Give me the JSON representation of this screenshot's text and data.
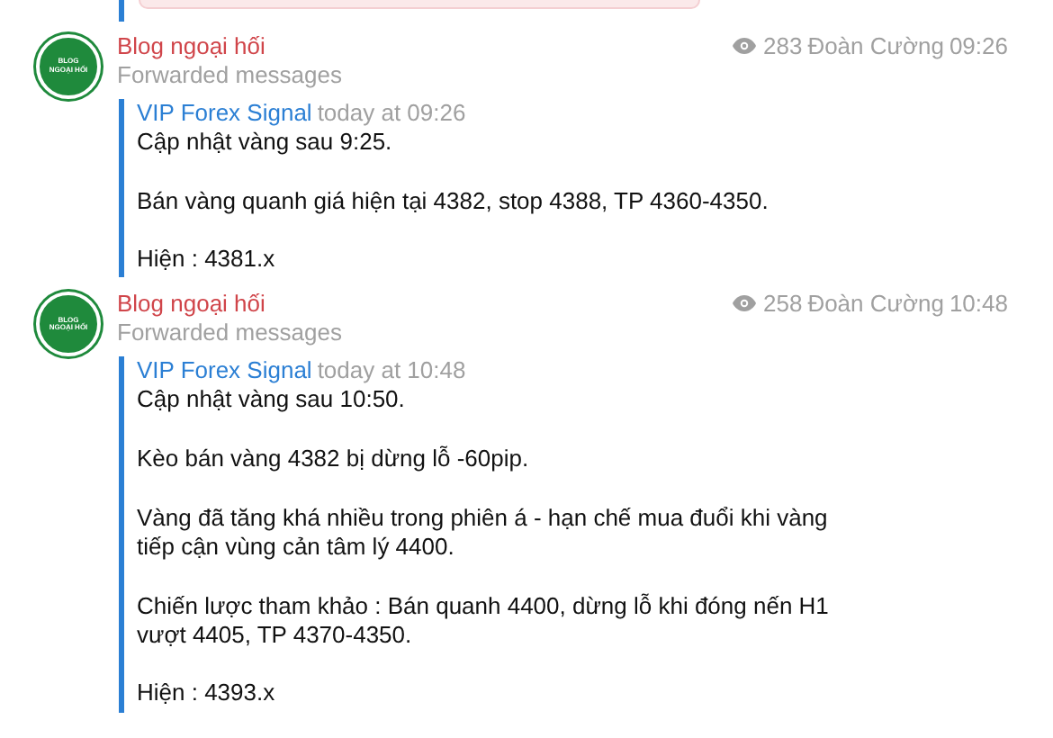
{
  "messages": [
    {
      "channel": "Blog ngoại hối",
      "avatar_text": [
        "BLOG",
        "NGOẠI HỐI"
      ],
      "subtitle": "Forwarded messages",
      "views": "283",
      "author": "Đoàn Cường",
      "time": "09:26",
      "forward": {
        "source": "VIP Forex Signal",
        "date": "today at 09:26",
        "text": "Cập nhật vàng sau 9:25.\n\nBán vàng quanh giá hiện tại 4382, stop 4388, TP 4360-4350.\n\nHiện : 4381.x"
      }
    },
    {
      "channel": "Blog ngoại hối",
      "avatar_text": [
        "BLOG",
        "NGOẠI HỐI"
      ],
      "subtitle": "Forwarded messages",
      "views": "258",
      "author": "Đoàn Cường",
      "time": "10:48",
      "forward": {
        "source": "VIP Forex Signal",
        "date": "today at 10:48",
        "text": "Cập nhật vàng sau 10:50.\n\nKèo bán vàng 4382 bị dừng lỗ -60pip.\n\nVàng đã tăng khá nhiều trong phiên á - hạn chế mua đuổi khi vàng\ntiếp cận vùng cản tâm lý 4400.\n\nChiến lược tham khảo : Bán quanh 4400, dừng lỗ khi đóng nến H1\nvượt 4405, TP 4370-4350.\n\nHiện : 4393.x"
      }
    }
  ]
}
